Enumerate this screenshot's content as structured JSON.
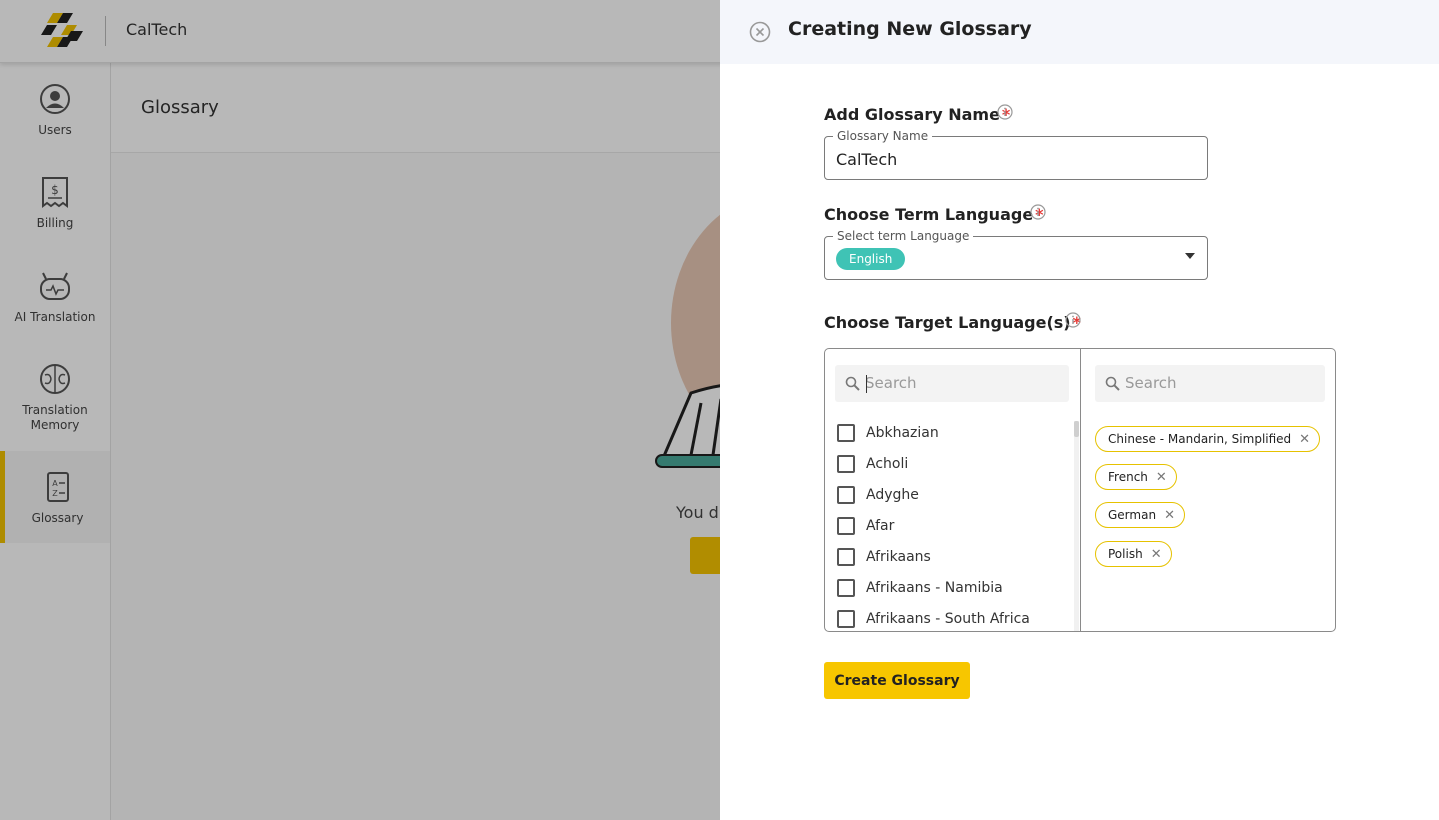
{
  "app": {
    "brand": "CalTech"
  },
  "sidebar": {
    "items": [
      {
        "label": "Users",
        "icon": "user-circle-icon"
      },
      {
        "label": "Billing",
        "icon": "receipt-icon"
      },
      {
        "label": "AI Translation",
        "icon": "robot-icon"
      },
      {
        "label": "Translation Memory",
        "icon": "brain-icon"
      },
      {
        "label": "Glossary",
        "icon": "glossary-book-icon",
        "active": true
      }
    ]
  },
  "page": {
    "title": "Glossary",
    "empty_text": "You d"
  },
  "drawer": {
    "title": "Creating New Glossary",
    "glossary_name": {
      "label": "Add Glossary Name",
      "floating_label": "Glossary Name",
      "value": "CalTech"
    },
    "term_language": {
      "label": "Choose Term Language",
      "floating_label": "Select term Language",
      "selected": "English"
    },
    "target_languages": {
      "label": "Choose Target Language(s)",
      "search_placeholder": "Search",
      "selected_search_placeholder": "Search",
      "options": [
        "Abkhazian",
        "Acholi",
        "Adyghe",
        "Afar",
        "Afrikaans",
        "Afrikaans - Namibia",
        "Afrikaans - South Africa"
      ],
      "selected": [
        "Chinese - Mandarin, Simplified",
        "French",
        "German",
        "Polish"
      ]
    },
    "submit_label": "Create Glossary",
    "required_mark": "*"
  },
  "colors": {
    "accent": "#f7c600",
    "chip_teal": "#3fc3b5",
    "required": "#e53935"
  }
}
